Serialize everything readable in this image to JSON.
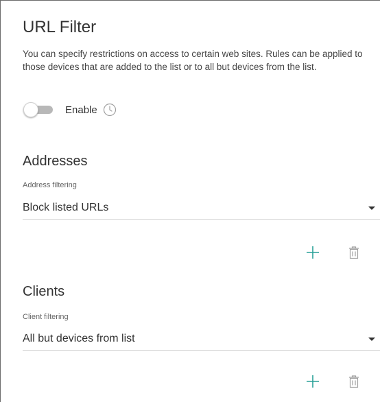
{
  "page": {
    "title": "URL Filter",
    "description": "You can specify restrictions on access to certain web sites. Rules can be applied to those devices that are added to the list or to all but devices from the list."
  },
  "enable": {
    "label": "Enable",
    "checked": false
  },
  "addresses": {
    "heading": "Addresses",
    "filter_label": "Address filtering",
    "filter_value": "Block listed URLs"
  },
  "clients": {
    "heading": "Clients",
    "filter_label": "Client filtering",
    "filter_value": "All but devices from list"
  },
  "colors": {
    "accent": "#2aa198",
    "icon_gray": "#a0a0a0",
    "text": "#333333"
  },
  "icons": [
    "clock-icon",
    "plus-icon",
    "trash-icon",
    "caret-down-icon"
  ]
}
